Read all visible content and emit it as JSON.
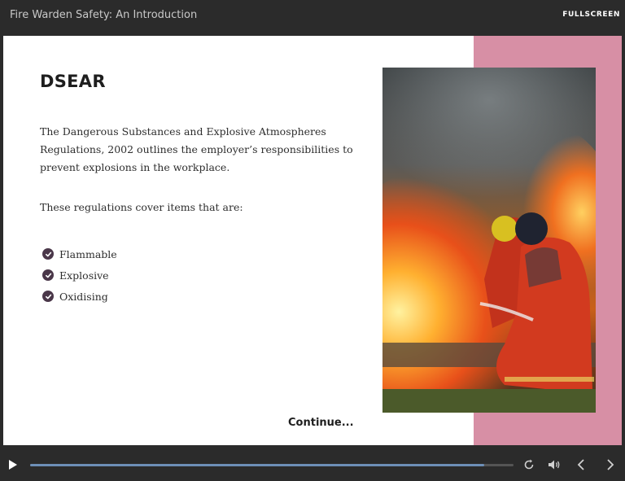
{
  "header": {
    "course_title": "Fire Warden Safety: An Introduction",
    "fullscreen_label": "FULLSCREEN"
  },
  "slide": {
    "heading": "DSEAR",
    "paragraph": "The Dangerous Substances and Explosive Atmospheres Regulations, 2002 outlines the employer’s responsibilities to prevent explosions in the workplace.",
    "intro": "These regulations cover items that are:",
    "bullets": [
      "Flammable",
      "Explosive",
      "Oxidising"
    ],
    "continue_label": "Continue..."
  },
  "player": {
    "progress": 0.94,
    "icons": [
      "play-icon",
      "replay-icon",
      "volume-icon",
      "chevron-left-icon",
      "chevron-right-icon"
    ]
  },
  "colors": {
    "accent_pink": "#d78fa5",
    "check_purple": "#4a3749",
    "progress_blue": "#6d8fb7"
  }
}
